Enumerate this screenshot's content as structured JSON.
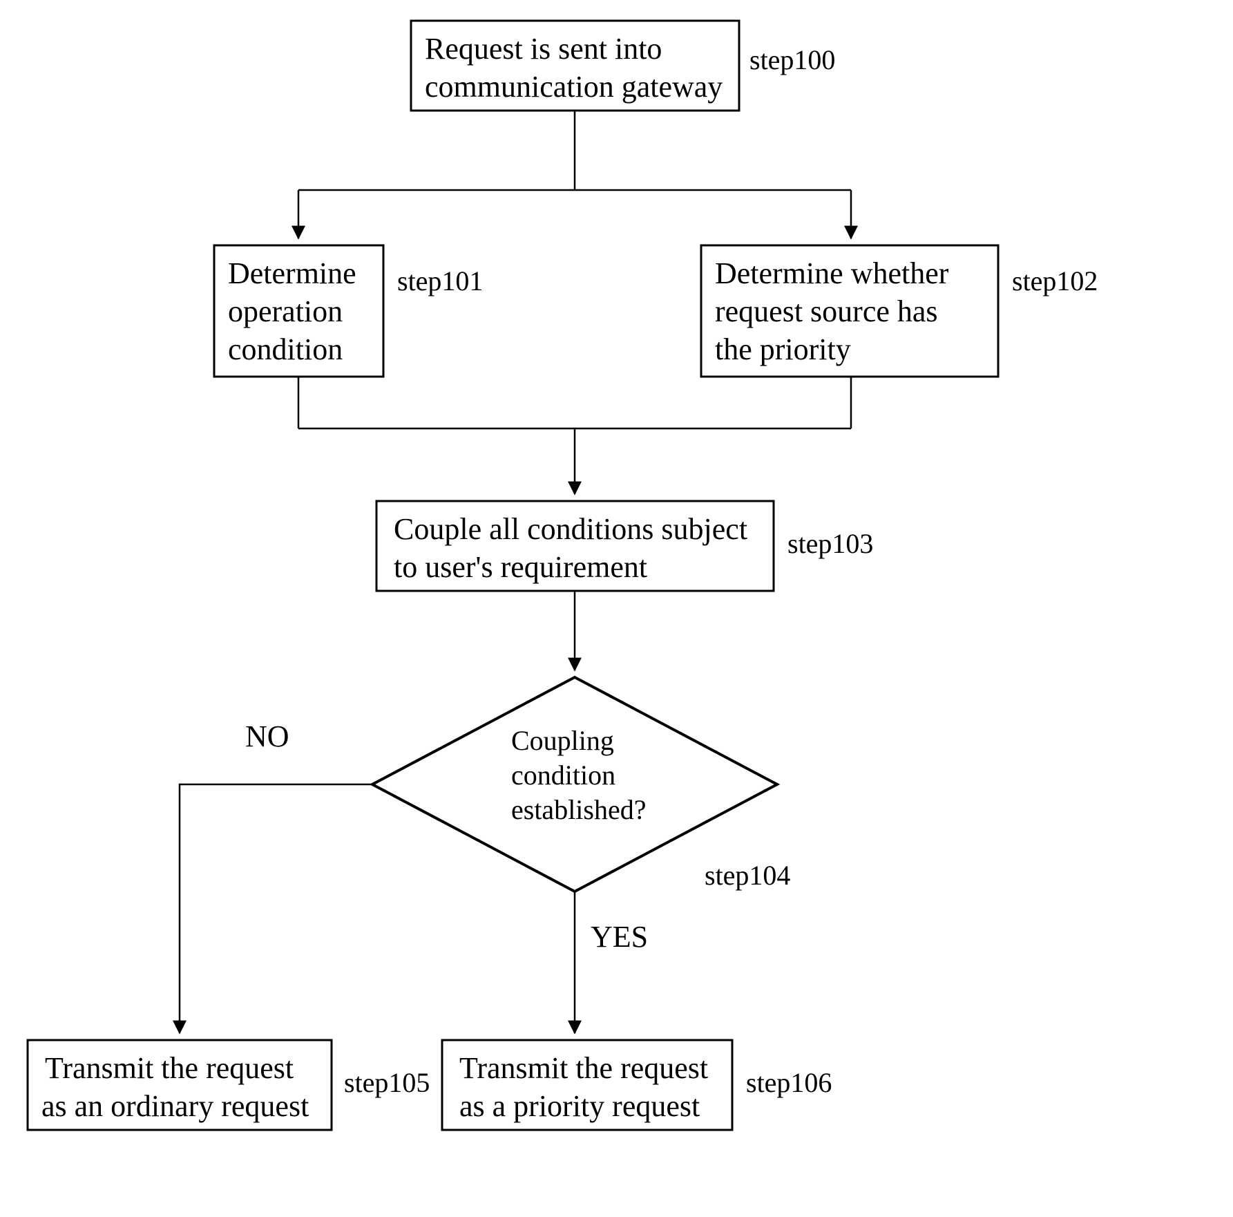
{
  "nodes": {
    "step100": {
      "label": "step100",
      "line1": "Request is sent into",
      "line2": "communication gateway"
    },
    "step101": {
      "label": "step101",
      "line1": "Determine",
      "line2": "operation",
      "line3": "condition"
    },
    "step102": {
      "label": "step102",
      "line1": "Determine whether",
      "line2": "request source has",
      "line3": "the priority"
    },
    "step103": {
      "label": "step103",
      "line1": "Couple all conditions subject",
      "line2": " to user's requirement"
    },
    "step104": {
      "label": "step104",
      "line1": "Coupling",
      "line2": "condition",
      "line3": "established?"
    },
    "step105": {
      "label": "step105",
      "line1": "Transmit the request",
      "line2": "as an ordinary request"
    },
    "step106": {
      "label": "step106",
      "line1": "Transmit the request",
      "line2": "as a priority request"
    }
  },
  "edges": {
    "no": "NO",
    "yes": "YES"
  }
}
